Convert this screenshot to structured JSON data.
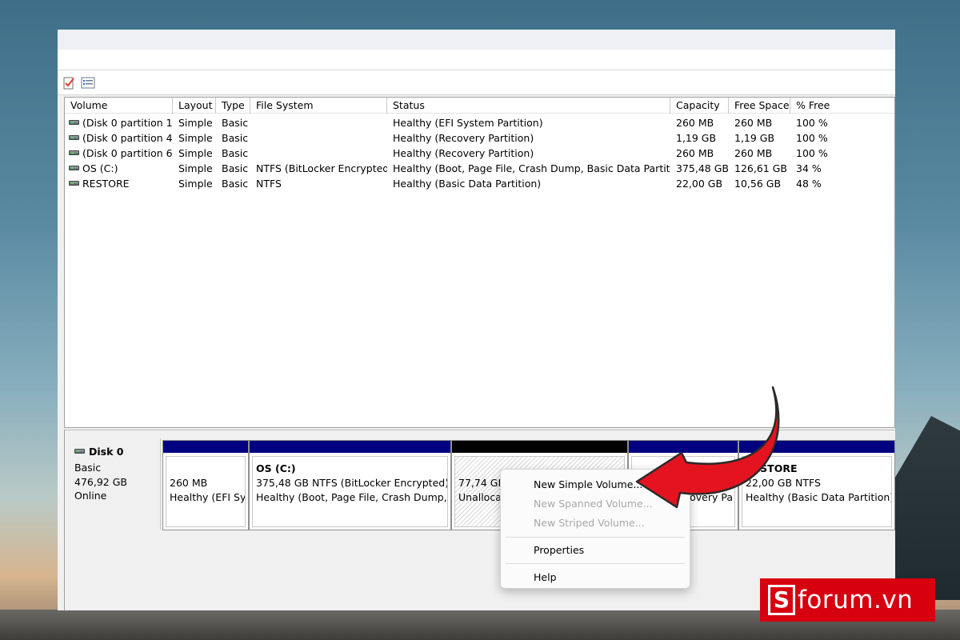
{
  "list": {
    "columns": [
      "Volume",
      "Layout",
      "Type",
      "File System",
      "Status",
      "Capacity",
      "Free Space",
      "% Free"
    ],
    "rows": [
      [
        "(Disk 0 partition 1)",
        "Simple",
        "Basic",
        "",
        "Healthy (EFI System Partition)",
        "260 MB",
        "260 MB",
        "100 %"
      ],
      [
        "(Disk 0 partition 4)",
        "Simple",
        "Basic",
        "",
        "Healthy (Recovery Partition)",
        "1,19 GB",
        "1,19 GB",
        "100 %"
      ],
      [
        "(Disk 0 partition 6)",
        "Simple",
        "Basic",
        "",
        "Healthy (Recovery Partition)",
        "260 MB",
        "260 MB",
        "100 %"
      ],
      [
        "OS (C:)",
        "Simple",
        "Basic",
        "NTFS (BitLocker Encrypted)",
        "Healthy (Boot, Page File, Crash Dump, Basic Data Partition)",
        "375,48 GB",
        "126,61 GB",
        "34 %"
      ],
      [
        "RESTORE",
        "Simple",
        "Basic",
        "NTFS",
        "Healthy (Basic Data Partition)",
        "22,00 GB",
        "10,56 GB",
        "48 %"
      ]
    ]
  },
  "disk": {
    "name": "Disk 0",
    "type": "Basic",
    "size": "476,92 GB",
    "status": "Online"
  },
  "partitions": [
    {
      "line1": "260 MB",
      "line2": "Healthy (EFI Sys"
    },
    {
      "title": "OS  (C:)",
      "line1": "375,48 GB NTFS (BitLocker Encrypted)",
      "line2": "Healthy (Boot, Page File, Crash Dump, Ba"
    },
    {
      "line1": "77,74 GB",
      "line2": "Unallocated"
    },
    {
      "line2": "covery Pa"
    },
    {
      "title": "RESTORE",
      "line1": "22,00 GB NTFS",
      "line2": "Healthy (Basic Data Partition)"
    }
  ],
  "context_menu": {
    "new_simple": "New Simple Volume...",
    "new_spanned": "New Spanned Volume...",
    "new_striped": "New Striped Volume...",
    "properties": "Properties",
    "help": "Help"
  },
  "watermark": {
    "letter": "S",
    "text": "forum.vn"
  },
  "colors": {
    "partition_bar": "#000080",
    "unallocated_bar": "#000000",
    "arrow": "#e3141f",
    "logo_bg": "#d7000f"
  },
  "icons": [
    "properties-check-icon",
    "list-view-icon",
    "drive-icon",
    "curved-arrow-icon"
  ]
}
